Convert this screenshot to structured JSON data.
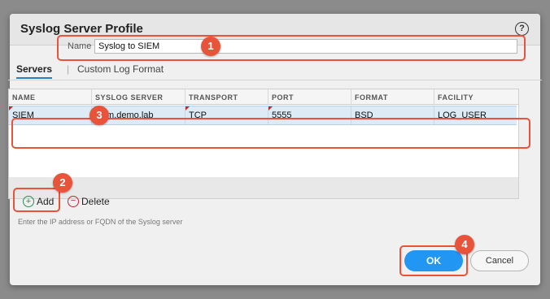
{
  "dialog": {
    "title": "Syslog Server Profile",
    "help_icon_glyph": "?"
  },
  "name_field": {
    "label": "Name",
    "value": "Syslog to SIEM"
  },
  "tabs": [
    {
      "label": "Servers",
      "active": true
    },
    {
      "label": "Custom Log Format",
      "active": false
    }
  ],
  "table": {
    "columns": [
      "NAME",
      "SYSLOG SERVER",
      "TRANSPORT",
      "PORT",
      "FORMAT",
      "FACILITY"
    ],
    "rows": [
      [
        "SIEM",
        "siem.demo.lab",
        "TCP",
        "5555",
        "BSD",
        "LOG_USER"
      ]
    ]
  },
  "actions": {
    "add_label": "Add",
    "delete_label": "Delete",
    "add_glyph": "+",
    "delete_glyph": "−"
  },
  "hint": "Enter the IP address or FQDN of the Syslog server",
  "footer": {
    "ok_label": "OK",
    "cancel_label": "Cancel"
  },
  "callouts": [
    "1",
    "2",
    "3",
    "4"
  ],
  "colors": {
    "accent_blue": "#2196f3",
    "callout_orange": "#e8533a",
    "selected_row": "#dcebf6"
  }
}
